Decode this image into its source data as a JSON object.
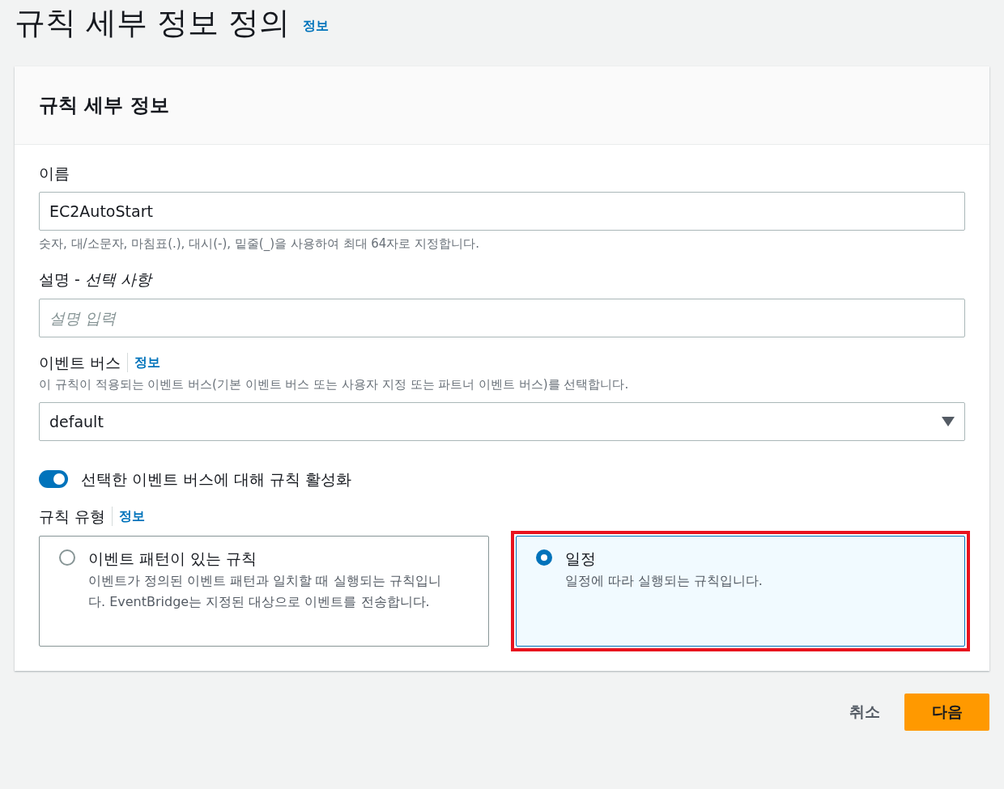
{
  "page": {
    "title": "규칙 세부 정보 정의",
    "info_link": "정보"
  },
  "card": {
    "title": "규칙 세부 정보"
  },
  "name_field": {
    "label": "이름",
    "value": "EC2AutoStart",
    "hint": "숫자, 대/소문자, 마침표(.), 대시(-), 밑줄(_)을 사용하여 최대 64자로 지정합니다."
  },
  "description_field": {
    "label": "설명 - ",
    "label_optional": "선택 사항",
    "placeholder": "설명 입력"
  },
  "event_bus": {
    "label": "이벤트 버스",
    "info_link": "정보",
    "hint": "이 규칙이 적용되는 이벤트 버스(기본 이벤트 버스 또는 사용자 지정 또는 파트너 이벤트 버스)를 선택합니다.",
    "value": "default"
  },
  "enable_toggle": {
    "label": "선택한 이벤트 버스에 대해 규칙 활성화",
    "on": true
  },
  "rule_type": {
    "label": "규칙 유형",
    "info_link": "정보",
    "options": [
      {
        "title": "이벤트 패턴이 있는 규칙",
        "description": "이벤트가 정의된 이벤트 패턴과 일치할 때 실행되는 규칙입니다. EventBridge는 지정된 대상으로 이벤트를 전송합니다.",
        "selected": false,
        "highlighted": false
      },
      {
        "title": "일정",
        "description": "일정에 따라 실행되는 규칙입니다.",
        "selected": true,
        "highlighted": true
      }
    ]
  },
  "buttons": {
    "cancel": "취소",
    "next": "다음"
  }
}
